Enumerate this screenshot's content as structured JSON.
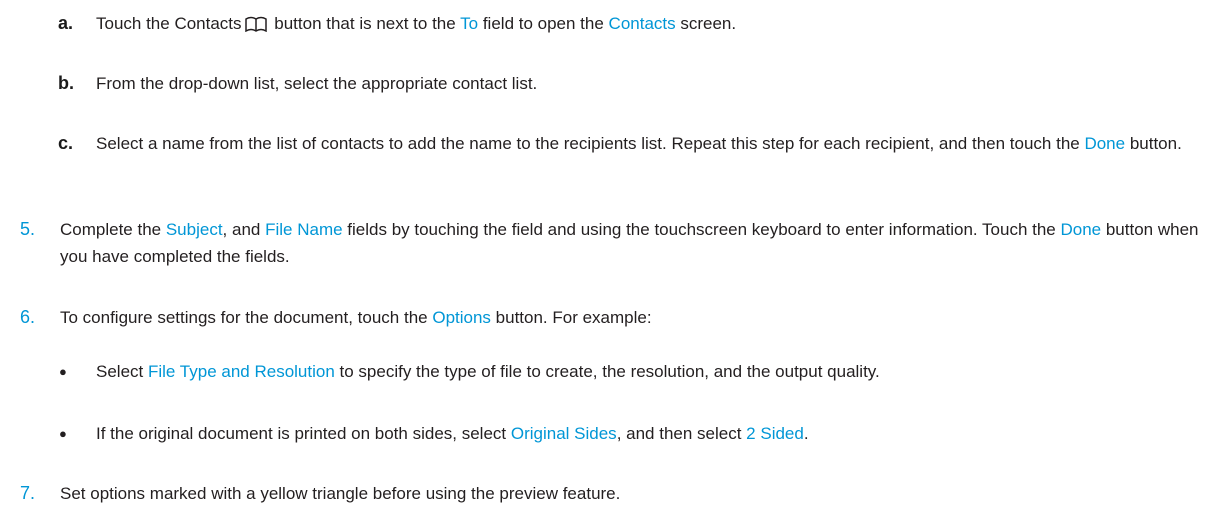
{
  "colors": {
    "link": "#0096d6",
    "text": "#231f20"
  },
  "steps": {
    "a": {
      "marker": "a.",
      "t1": "Touch the Contacts",
      "icon": "book-icon",
      "t2": " button that is next to the ",
      "l1": "To",
      "t3": " field to open the ",
      "l2": "Contacts",
      "t4": " screen."
    },
    "b": {
      "marker": "b.",
      "t1": "From the drop-down list, select the appropriate contact list."
    },
    "c": {
      "marker": "c.",
      "t1": "Select a name from the list of contacts to add the name to the recipients list. Repeat this step for each recipient, and then touch the ",
      "l1": "Done",
      "t2": " button."
    },
    "five": {
      "marker": "5.",
      "t1": "Complete the ",
      "l1": "Subject",
      "t2": ", and ",
      "l2": "File Name",
      "t3": " fields by touching the field and using the touchscreen keyboard to enter information. Touch the ",
      "l3": "Done",
      "t4": " button when you have completed the fields."
    },
    "six": {
      "marker": "6.",
      "t1": "To configure settings for the document, touch the ",
      "l1": "Options",
      "t2": " button. For example:"
    },
    "bullet1": {
      "marker": "●",
      "t1": "Select ",
      "l1": "File Type and Resolution",
      "t2": " to specify the type of file to create, the resolution, and the output quality."
    },
    "bullet2": {
      "marker": "●",
      "t1": "If the original document is printed on both sides, select ",
      "l1": "Original Sides",
      "t2": ", and then select ",
      "l2": "2 Sided",
      "t3": "."
    },
    "seven": {
      "marker": "7.",
      "t1": "Set options marked with a yellow triangle before using the preview feature."
    }
  }
}
